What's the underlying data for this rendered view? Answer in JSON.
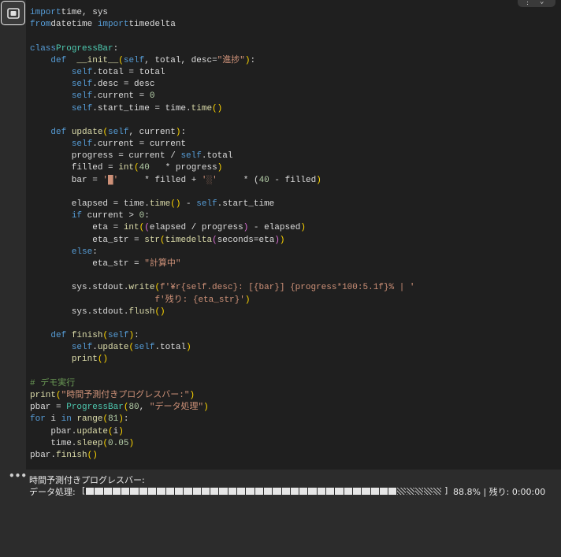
{
  "toolbar": {
    "run_icon": "run-cell-icon",
    "more_icon": "ellipsis-icon",
    "chevron_icon": "chevron-down-icon"
  },
  "code_lines": [
    [
      [
        "kw",
        "import"
      ],
      [
        "",
        "time, sys"
      ]
    ],
    [
      [
        "kw",
        "from"
      ],
      [
        "",
        "datetime "
      ],
      [
        "kw",
        "import"
      ],
      [
        "",
        "timedelta"
      ]
    ],
    [],
    [
      [
        "kw",
        "class"
      ],
      [
        "cls",
        "ProgressBar"
      ],
      [
        "",
        ":"
      ]
    ],
    [
      [
        "",
        "    "
      ],
      [
        "kw",
        "def"
      ],
      [
        "",
        "  "
      ],
      [
        "fn",
        "__init__"
      ],
      [
        "br",
        "("
      ],
      [
        "sf",
        "self"
      ],
      [
        "",
        ", total, desc="
      ],
      [
        "st",
        "\"進捗\""
      ],
      [
        "br",
        ")"
      ],
      [
        "",
        ":"
      ]
    ],
    [
      [
        "",
        "        "
      ],
      [
        "sf",
        "self"
      ],
      [
        "",
        ".total = total"
      ]
    ],
    [
      [
        "",
        "        "
      ],
      [
        "sf",
        "self"
      ],
      [
        "",
        ".desc = desc"
      ]
    ],
    [
      [
        "",
        "        "
      ],
      [
        "sf",
        "self"
      ],
      [
        "",
        ".current = "
      ],
      [
        "nm",
        "0"
      ]
    ],
    [
      [
        "",
        "        "
      ],
      [
        "sf",
        "self"
      ],
      [
        "",
        ".start_time = time."
      ],
      [
        "fn",
        "time"
      ],
      [
        "br",
        "()"
      ]
    ],
    [],
    [
      [
        "",
        "    "
      ],
      [
        "kw",
        "def"
      ],
      [
        "",
        ""
      ],
      [
        "fn",
        "update"
      ],
      [
        "br",
        "("
      ],
      [
        "sf",
        "self"
      ],
      [
        "",
        ", current"
      ],
      [
        "br",
        ")"
      ],
      [
        "",
        ":"
      ]
    ],
    [
      [
        "",
        "        "
      ],
      [
        "sf",
        "self"
      ],
      [
        "",
        ".current = current"
      ]
    ],
    [
      [
        "",
        "        progress = current / "
      ],
      [
        "sf",
        "self"
      ],
      [
        "",
        ".total"
      ]
    ],
    [
      [
        "",
        "        filled = "
      ],
      [
        "fn",
        "int"
      ],
      [
        "br",
        "("
      ],
      [
        "nm",
        "40"
      ],
      [
        "",
        ""
      ],
      [
        "",
        ""
      ],
      [
        "",
        ""
      ],
      [
        "",
        "*"
      ],
      [
        "",
        ""
      ],
      [
        "",
        "progress"
      ],
      [
        "br",
        ")"
      ]
    ],
    [
      [
        "",
        "        bar = "
      ],
      [
        "st",
        "'█'"
      ],
      [
        "",
        ""
      ],
      [
        "",
        ""
      ],
      [
        "",
        ""
      ],
      [
        "",
        ""
      ],
      [
        "",
        ""
      ],
      [
        "",
        "* filled + "
      ],
      [
        "st",
        "'░'"
      ],
      [
        "",
        ""
      ],
      [
        "",
        ""
      ],
      [
        "",
        ""
      ],
      [
        "",
        ""
      ],
      [
        "",
        ""
      ],
      [
        "",
        "* ("
      ],
      [
        "nm",
        "40"
      ],
      [
        "",
        ""
      ],
      [
        "",
        "- filled"
      ],
      [
        "br",
        ")"
      ]
    ],
    [],
    [
      [
        "",
        "        elapsed = time."
      ],
      [
        "fn",
        "time"
      ],
      [
        "br",
        "()"
      ],
      [
        "",
        ""
      ],
      [
        "",
        "- "
      ],
      [
        "sf",
        "self"
      ],
      [
        "",
        ".start_time"
      ]
    ],
    [
      [
        "",
        "        "
      ],
      [
        "kw",
        "if"
      ],
      [
        "",
        ""
      ],
      [
        "",
        "current > "
      ],
      [
        "nm",
        "0"
      ],
      [
        "",
        ":"
      ]
    ],
    [
      [
        "",
        "            eta = "
      ],
      [
        "fn",
        "int"
      ],
      [
        "br",
        "("
      ],
      [
        "bp",
        "("
      ],
      [
        "",
        "elapsed / progress"
      ],
      [
        "bp",
        ")"
      ],
      [
        "",
        ""
      ],
      [
        "",
        "- elapsed"
      ],
      [
        "br",
        ")"
      ]
    ],
    [
      [
        "",
        "            eta_str = "
      ],
      [
        "fn",
        "str"
      ],
      [
        "br",
        "("
      ],
      [
        "fn",
        "timedelta"
      ],
      [
        "bp",
        "("
      ],
      [
        "",
        "seconds=eta"
      ],
      [
        "bp",
        ")"
      ],
      [
        "br",
        ")"
      ]
    ],
    [
      [
        "",
        "        "
      ],
      [
        "kw",
        "else"
      ],
      [
        "",
        ":"
      ]
    ],
    [
      [
        "",
        "            eta_str = "
      ],
      [
        "st",
        "\"計算中\""
      ]
    ],
    [],
    [
      [
        "",
        "        sys.stdout."
      ],
      [
        "fn",
        "write"
      ],
      [
        "br",
        "("
      ],
      [
        "st",
        "f'¥r{self.desc}: [{bar}] {progress*100:5.1f}% | '"
      ]
    ],
    [
      [
        "",
        "                        "
      ],
      [
        "st",
        "f'残り: {eta_str}'"
      ],
      [
        "br",
        ")"
      ]
    ],
    [
      [
        "",
        "        sys.stdout."
      ],
      [
        "fn",
        "flush"
      ],
      [
        "br",
        "()"
      ]
    ],
    [],
    [
      [
        "",
        "    "
      ],
      [
        "kw",
        "def"
      ],
      [
        "",
        ""
      ],
      [
        "fn",
        "finish"
      ],
      [
        "br",
        "("
      ],
      [
        "sf",
        "self"
      ],
      [
        "br",
        ")"
      ],
      [
        "",
        ":"
      ]
    ],
    [
      [
        "",
        "        "
      ],
      [
        "sf",
        "self"
      ],
      [
        "",
        "."
      ],
      [
        "fn",
        "update"
      ],
      [
        "br",
        "("
      ],
      [
        "sf",
        "self"
      ],
      [
        "",
        ".total"
      ],
      [
        "br",
        ")"
      ]
    ],
    [
      [
        "",
        "        "
      ],
      [
        "fn",
        "print"
      ],
      [
        "br",
        "()"
      ]
    ],
    [],
    [
      [
        "cm",
        "# デモ実行"
      ]
    ],
    [
      [
        "fn",
        "print"
      ],
      [
        "br",
        "("
      ],
      [
        "st",
        "\"時間予測付きプログレスバー:\""
      ],
      [
        "br",
        ")"
      ]
    ],
    [
      [
        "",
        "pbar = "
      ],
      [
        "cls",
        "ProgressBar"
      ],
      [
        "br",
        "("
      ],
      [
        "nm",
        "80"
      ],
      [
        "",
        ", "
      ],
      [
        "st",
        "\"データ処理\""
      ],
      [
        "br",
        ")"
      ]
    ],
    [
      [
        "kw",
        "for"
      ],
      [
        "",
        ""
      ],
      [
        "",
        "i "
      ],
      [
        "kw",
        "in"
      ],
      [
        "",
        ""
      ],
      [
        "fn",
        "range"
      ],
      [
        "br",
        "("
      ],
      [
        "nm",
        "81"
      ],
      [
        "br",
        ")"
      ],
      [
        "",
        ":"
      ]
    ],
    [
      [
        "",
        "    pbar."
      ],
      [
        "fn",
        "update"
      ],
      [
        "br",
        "("
      ],
      [
        "",
        "i"
      ],
      [
        "br",
        ")"
      ]
    ],
    [
      [
        "",
        "    time."
      ],
      [
        "fn",
        "sleep"
      ],
      [
        "br",
        "("
      ],
      [
        "nm",
        "0.05"
      ],
      [
        "br",
        ")"
      ]
    ],
    [
      [
        "",
        "pbar."
      ],
      [
        "fn",
        "finish"
      ],
      [
        "br",
        "()"
      ]
    ]
  ],
  "output": {
    "line1": "時間予測付きプログレスバー:",
    "bar_label": "データ処理:",
    "bar_open": "[",
    "bar_close": "]",
    "progress_fraction": 0.888,
    "bar_segments": 40,
    "percent_text": "88.8% | 残り: 0:00:00"
  },
  "colors": {
    "keyword": "#569cd6",
    "function": "#dcdcaa",
    "string": "#ce9178",
    "number": "#b5cea8",
    "comment": "#6a9955",
    "class": "#4ec9b0",
    "exec_marker": "#2ea043"
  }
}
